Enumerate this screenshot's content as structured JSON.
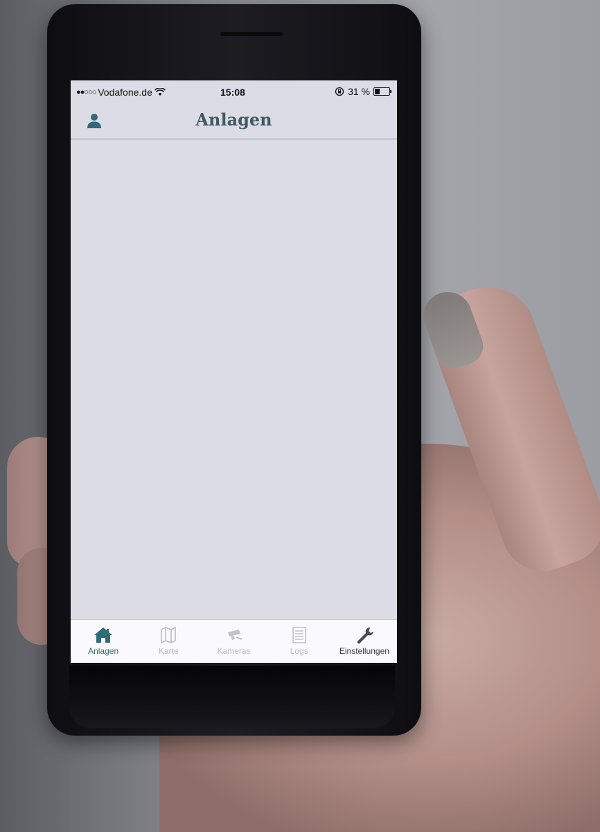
{
  "status_bar": {
    "signal": "●●○○○",
    "carrier": "Vodafone.de",
    "time": "15:08",
    "battery_text": "31 %"
  },
  "nav": {
    "title": "Anlagen",
    "user_icon": "user-icon"
  },
  "tabs": [
    {
      "label": "Anlagen",
      "icon": "house-icon",
      "active": true
    },
    {
      "label": "Karte",
      "icon": "map-icon",
      "active": false
    },
    {
      "label": "Kameras",
      "icon": "camera-icon",
      "active": false
    },
    {
      "label": "Logs",
      "icon": "list-icon",
      "active": false
    },
    {
      "label": "Einstellungen",
      "icon": "wrench-icon",
      "active": false
    }
  ],
  "colors": {
    "accent": "#2f6b78",
    "screen_bg": "#dcdce6",
    "tab_inactive": "#bbbbc2"
  }
}
